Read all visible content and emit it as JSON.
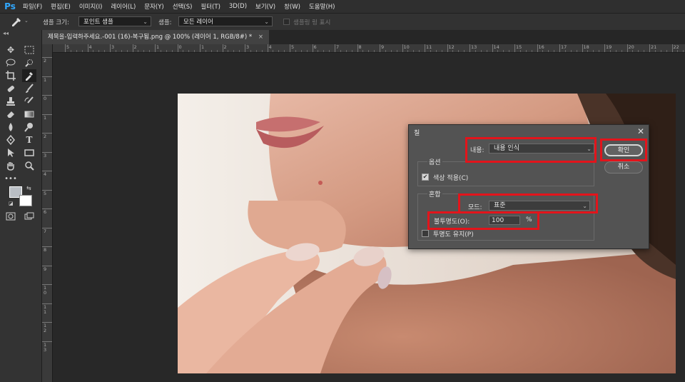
{
  "app": {
    "logo": "Ps"
  },
  "menu": [
    "파일(F)",
    "편집(E)",
    "이미지(I)",
    "레이어(L)",
    "문자(Y)",
    "선택(S)",
    "필터(T)",
    "3D(D)",
    "보기(V)",
    "창(W)",
    "도움말(H)"
  ],
  "options_bar": {
    "sample_size_label": "샘플 크기:",
    "sample_size_value": "포인트 샘플",
    "sample_label": "샘플:",
    "sample_value": "모든 레이어",
    "show_ring_label": "샘플링 링 표시"
  },
  "tools_panel": {
    "collapse": "◂◂",
    "foreground_color": "#b9bec4",
    "background_color": "#ffffff"
  },
  "document_tab": {
    "title": "제목을-입력하주세요.-001 (16)-복구됨.png @ 100% (레이어 1, RGB/8#) *",
    "close": "×"
  },
  "ruler": {
    "top_labels": [
      "5",
      "4",
      "3",
      "2",
      "1",
      "0",
      "1",
      "2",
      "3",
      "4",
      "5",
      "6",
      "7",
      "8",
      "9",
      "10",
      "11",
      "12",
      "13",
      "14",
      "15",
      "16",
      "17",
      "18",
      "19",
      "20",
      "21",
      "22"
    ],
    "left_labels": [
      "2",
      "1",
      "0",
      "1",
      "2",
      "3",
      "4",
      "5",
      "6",
      "7",
      "8",
      "9",
      "10",
      "11",
      "12",
      "13"
    ]
  },
  "fill_dialog": {
    "title": "칠",
    "close": "✕",
    "contents_label": "내용:",
    "contents_value": "내용 인식",
    "options_group": "옵션",
    "color_adaptation_label": "색상 적용(C)",
    "color_adaptation_checked": true,
    "blending_group": "혼합",
    "mode_label": "모드:",
    "mode_value": "표준",
    "opacity_label": "불투명도(O):",
    "opacity_value": "100",
    "opacity_unit": "%",
    "preserve_transparency_label": "투명도 유지(P)",
    "preserve_transparency_checked": false,
    "ok_label": "확인",
    "cancel_label": "취소"
  },
  "highlight_color": "#e3141b"
}
